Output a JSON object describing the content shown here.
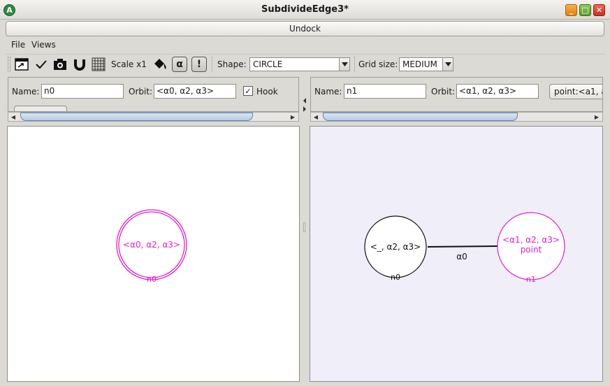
{
  "window": {
    "title": "SubdivideEdge3*",
    "app_icon_letter": "A"
  },
  "undock_button": "Undock",
  "menu": [
    "File",
    "Views"
  ],
  "toolbar": {
    "scale_label": "Scale x1",
    "alpha_toggle": "α",
    "alert_toggle": "!",
    "shape_label": "Shape:",
    "shape_value": "CIRCLE",
    "grid_label": "Grid size:",
    "grid_value": "MEDIUM"
  },
  "left_panel": {
    "name_label": "Name:",
    "name_value": "n0",
    "orbit_label": "Orbit:",
    "orbit_value": "<α0, α2, α3>",
    "hook_label": "Hook",
    "hook_checked": true
  },
  "right_panel": {
    "name_label": "Name:",
    "name_value": "n1",
    "orbit_label": "Orbit:",
    "orbit_value": "<α1, α2, α3>",
    "point_button": "point:<a1, a"
  },
  "left_graph": {
    "node": {
      "name": "n0",
      "orbit": "<α0, α2, α3>",
      "color": "#e020c8",
      "hook": true
    }
  },
  "right_graph": {
    "nodes": [
      {
        "name": "n0",
        "orbit": "<_, α2, α3>",
        "color": "#000000"
      },
      {
        "name": "n1",
        "orbit": "<α1, α2, α3>",
        "sub": "point",
        "color": "#e020c8"
      }
    ],
    "edge_label": "α0"
  },
  "colors": {
    "magenta": "#e020c8",
    "canvas_right_bg": "#efeef9"
  }
}
